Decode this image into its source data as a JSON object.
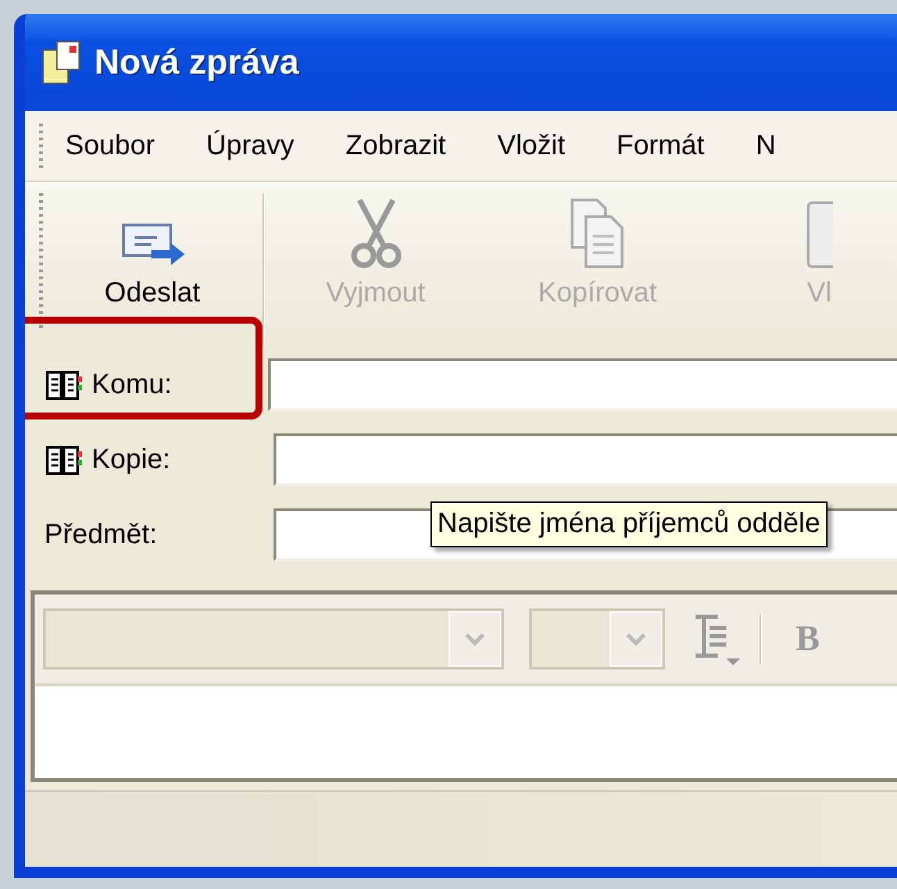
{
  "window": {
    "title": "Nová zpráva"
  },
  "menu": [
    "Soubor",
    "Úpravy",
    "Zobrazit",
    "Vložit",
    "Formát",
    "N"
  ],
  "toolbar": [
    {
      "label": "Odeslat",
      "kind": "send",
      "disabled": false
    },
    {
      "label": "Vyjmout",
      "kind": "cut",
      "disabled": true
    },
    {
      "label": "Kopírovat",
      "kind": "copy",
      "disabled": true
    },
    {
      "label": "Vl",
      "kind": "paste",
      "disabled": true
    }
  ],
  "fields": [
    {
      "label": "Komu:",
      "kind": "address",
      "highlighted": true
    },
    {
      "label": "Kopie:",
      "kind": "address",
      "highlighted": false
    },
    {
      "label": "Předmět:",
      "kind": "plain",
      "highlighted": false
    }
  ],
  "tooltip": "Napište jména příjemců odděle",
  "format_bar": {
    "bold": "B"
  }
}
